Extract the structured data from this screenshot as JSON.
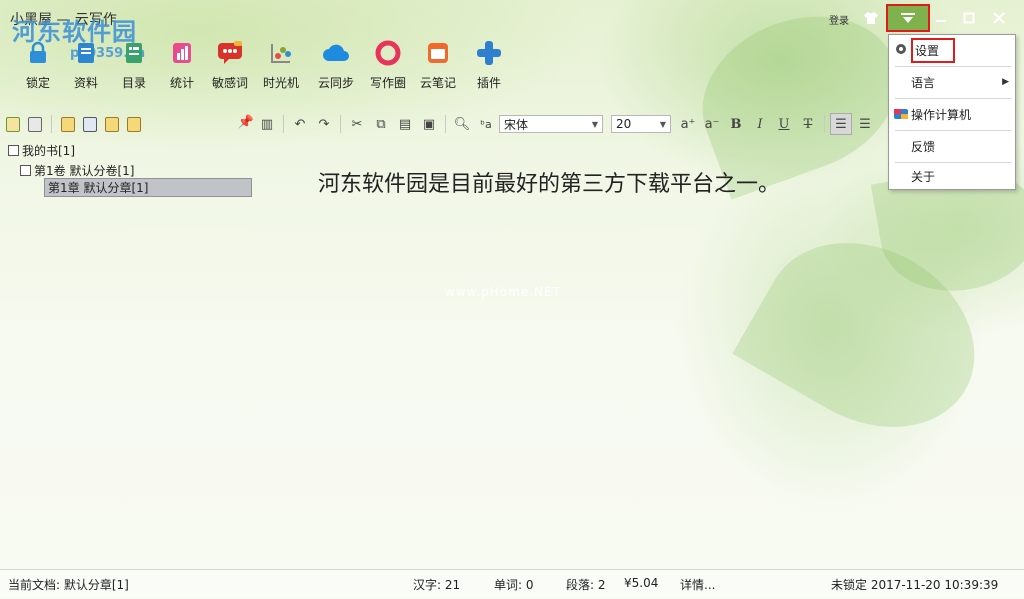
{
  "window": {
    "title": "小黑屋 — 云写作",
    "watermark_text": "河东软件园",
    "watermark_url": "pc0359.cn",
    "login_label": "登录"
  },
  "toolbar": {
    "items": [
      {
        "label": "锁定",
        "icon": "lock-icon",
        "color": "#2e8fd8"
      },
      {
        "label": "资料",
        "icon": "document-icon",
        "color": "#2a87d0"
      },
      {
        "label": "目录",
        "icon": "book-icon",
        "color": "#3aa36b"
      },
      {
        "label": "统计",
        "icon": "chart-icon",
        "color": "#e94b8f"
      },
      {
        "label": "敏感词",
        "icon": "chat-bubble-icon",
        "color": "#d9322b"
      },
      {
        "label": "时光机",
        "icon": "timeline-icon",
        "color": "#8aa23a"
      },
      {
        "label": "云同步",
        "icon": "cloud-icon",
        "color": "#1f8be0"
      },
      {
        "label": "写作圈",
        "icon": "ring-icon",
        "color": "#e8335a"
      },
      {
        "label": "云笔记",
        "icon": "notepad-icon",
        "color": "#ef6a2c"
      },
      {
        "label": "插件",
        "icon": "plus-icon",
        "color": "#2f7fd0"
      }
    ]
  },
  "format": {
    "font_name": "宋体",
    "font_size": "20"
  },
  "tree": {
    "book": "我的书[1]",
    "volume": "第1卷 默认分卷[1]",
    "chapter": "第1章 默认分章[1]"
  },
  "editor": {
    "content": "河东软件园是目前最好的第三方下载平台之一。",
    "watermark": "www.pHome.NET"
  },
  "menu": {
    "items": [
      {
        "label": "设置",
        "icon": "gear-icon"
      },
      {
        "label": "语言",
        "icon": "",
        "has_submenu": true
      },
      {
        "label": "操作计算机",
        "icon": "palette-icon"
      },
      {
        "label": "反馈",
        "icon": ""
      },
      {
        "label": "关于",
        "icon": ""
      }
    ]
  },
  "status": {
    "current_doc": "当前文档: 默认分章[1]",
    "hanzi": "汉字: 21",
    "words": "单词: 0",
    "paragraphs": "段落: 2",
    "price": "¥5.04",
    "details": "详情...",
    "lock_time": "未锁定 2017-11-20 10:39:39"
  }
}
